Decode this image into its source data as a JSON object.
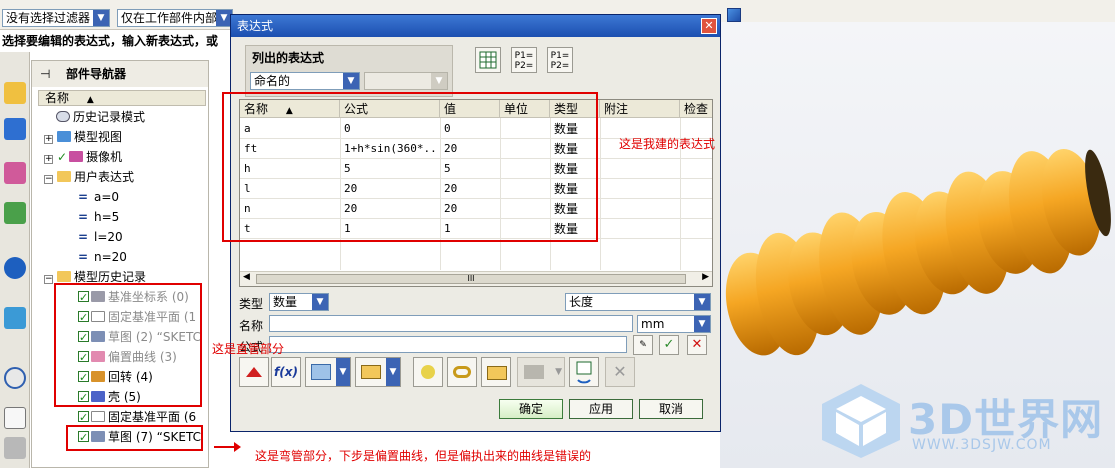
{
  "toolbar": {
    "filter_combo": "没有选择过滤器",
    "scope_combo": "仅在工作部件内部",
    "cue_line": "选择要编辑的表达式，输入新表达式，或"
  },
  "navigator": {
    "title": "部件导航器",
    "column_header": "名称",
    "items": [
      {
        "label": "历史记录模式"
      },
      {
        "label": "模型视图"
      },
      {
        "label": "摄像机"
      },
      {
        "label": "用户表达式"
      },
      {
        "label": "a=0"
      },
      {
        "label": "h=5"
      },
      {
        "label": "l=20"
      },
      {
        "label": "n=20"
      },
      {
        "label": "模型历史记录"
      },
      {
        "label": "基准坐标系",
        "suffix": "(0)"
      },
      {
        "label": "固定基准平面",
        "suffix": "(1"
      },
      {
        "label": "草图",
        "suffix": "(2) “SKETC"
      },
      {
        "label": "偏置曲线",
        "suffix": "(3)"
      },
      {
        "label": "回转",
        "suffix": "(4)"
      },
      {
        "label": "壳",
        "suffix": "(5)"
      },
      {
        "label": "固定基准平面",
        "suffix": "(6"
      },
      {
        "label": "草图",
        "suffix": "(7) “SKETC"
      }
    ]
  },
  "dialog": {
    "title": "表达式",
    "close_glyph": "✕",
    "listed_group_title": "列出的表达式",
    "listed_filter": "命名的",
    "toolbar_icons": [
      "spreadsheet-icon",
      "p1-p2-icon",
      "p1-p2-arrow-icon"
    ],
    "p_label": "P1= P2=",
    "columns": [
      "名称",
      "公式",
      "值",
      "单位",
      "类型",
      "附注",
      "检查"
    ],
    "rows": [
      {
        "name": "a",
        "formula": "0",
        "value": "0",
        "unit": "",
        "type": "数量"
      },
      {
        "name": "ft",
        "formula": "1+h*sin(360*...",
        "value": "20",
        "unit": "",
        "type": "数量"
      },
      {
        "name": "h",
        "formula": "5",
        "value": "5",
        "unit": "",
        "type": "数量"
      },
      {
        "name": "l",
        "formula": "20",
        "value": "20",
        "unit": "",
        "type": "数量"
      },
      {
        "name": "n",
        "formula": "20",
        "value": "20",
        "unit": "",
        "type": "数量"
      },
      {
        "name": "t",
        "formula": "1",
        "value": "1",
        "unit": "",
        "type": "数量"
      }
    ],
    "scroll_thumb_mark": "III",
    "type_label": "类型",
    "type_value": "数量",
    "dimension_value": "长度",
    "name_label": "名称",
    "units_value": "mm",
    "formula_label": "公式",
    "fx_label": "f(x)",
    "ok_label": "确定",
    "apply_label": "应用",
    "cancel_label": "取消"
  },
  "annotations": {
    "mine": "这是我建的表达式",
    "pipe": "这是直管部分",
    "bend": "这是弯管部分，下步是偏置曲线，但是偏执出来的曲线是错误的"
  },
  "watermark": {
    "brand": "3D世界网",
    "url": "WWW.3DSJW.COM"
  },
  "colors": {
    "annotation_red": "#e00000",
    "spring_orange": "#f5a623",
    "title_blue": "#1c4fb0"
  }
}
